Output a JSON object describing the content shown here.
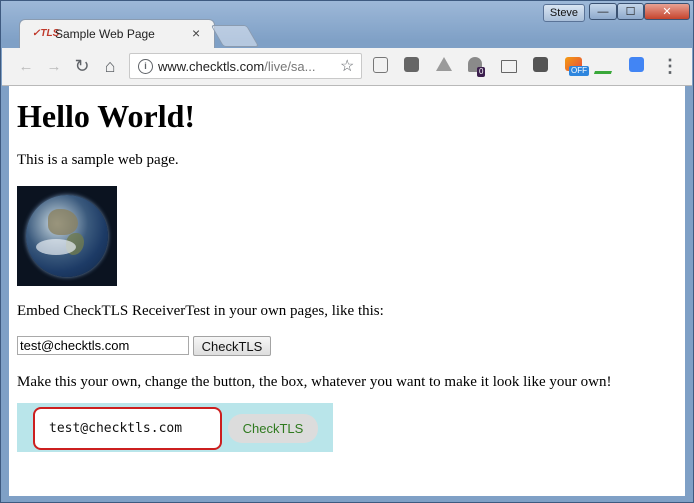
{
  "window": {
    "user_name": "Steve",
    "minimize_glyph": "—",
    "maximize_glyph": "☐",
    "close_glyph": "✕"
  },
  "tab": {
    "favicon_text": "✓TLS",
    "title": "Sample Web Page",
    "close_glyph": "×"
  },
  "toolbar": {
    "back_glyph": "←",
    "forward_glyph": "→",
    "reload_glyph": "↻",
    "home_glyph": "⌂",
    "info_glyph": "i",
    "url_host": "www.checktls.com",
    "url_path": "/live/sa...",
    "star_glyph": "☆",
    "extensions": [
      {
        "name": "reader-icon"
      },
      {
        "name": "pocket-icon"
      },
      {
        "name": "drive-icon"
      },
      {
        "name": "ghostery-icon",
        "badge": "0"
      },
      {
        "name": "cast-icon"
      },
      {
        "name": "lightbulb-icon"
      },
      {
        "name": "image-off-icon",
        "badge": "OFF"
      },
      {
        "name": "spellcheck-icon"
      },
      {
        "name": "translate-icon"
      }
    ],
    "menu_glyph": "⋮"
  },
  "page": {
    "heading": "Hello World!",
    "intro": "This is a sample web page.",
    "embed_text": "Embed CheckTLS ReceiverTest in your own pages, like this:",
    "form1": {
      "input_value": "test@checktls.com",
      "button_label": "CheckTLS"
    },
    "custom_text": "Make this your own, change the button, the box, whatever you want to make it look like your own!",
    "form2": {
      "input_value": "test@checktls.com",
      "button_label": "CheckTLS"
    }
  }
}
